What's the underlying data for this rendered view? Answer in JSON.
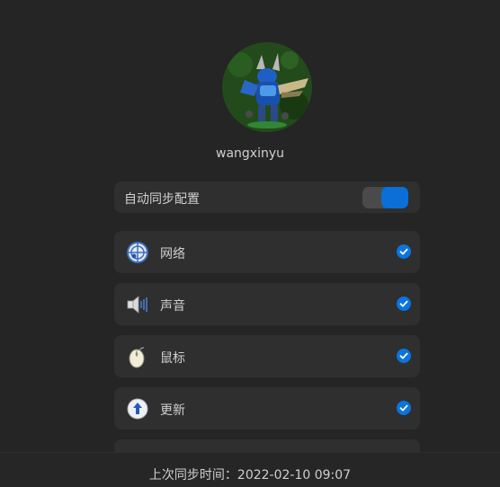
{
  "account": {
    "username": "wangxinyu"
  },
  "auto_sync": {
    "label": "自动同步配置",
    "enabled": true
  },
  "sync_items": [
    {
      "label": "网络",
      "icon": "network-icon",
      "checked": true
    },
    {
      "label": "声音",
      "icon": "sound-icon",
      "checked": true
    },
    {
      "label": "鼠标",
      "icon": "mouse-icon",
      "checked": true
    },
    {
      "label": "更新",
      "icon": "update-icon",
      "checked": true
    },
    {
      "label": "",
      "icon": "partial-item-icon",
      "checked": true
    }
  ],
  "footer": {
    "last_sync": "上次同步时间：2022-02-10 09:07"
  },
  "colors": {
    "accent": "#0a74e0",
    "background": "#252525",
    "card": "#2f2f2f"
  }
}
